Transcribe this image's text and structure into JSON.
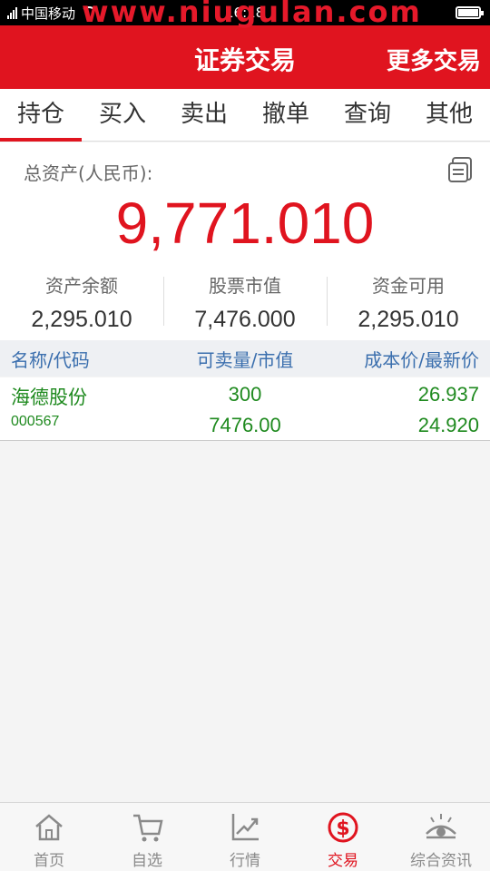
{
  "status": {
    "carrier": "中国移动",
    "time": "16:18",
    "watermark": "www.niugulan.com"
  },
  "header": {
    "title": "证券交易",
    "more": "更多交易"
  },
  "tabs": [
    "持仓",
    "买入",
    "卖出",
    "撤单",
    "查询",
    "其他"
  ],
  "assets": {
    "total_label": "总资产(人民币):",
    "total_value": "9,771.010",
    "stats": [
      {
        "label": "资产余额",
        "value": "2,295.010"
      },
      {
        "label": "股票市值",
        "value": "7,476.000"
      },
      {
        "label": "资金可用",
        "value": "2,295.010"
      }
    ]
  },
  "table": {
    "headers": [
      "名称/代码",
      "可卖量/市值",
      "成本价/最新价"
    ],
    "rows": [
      {
        "name": "海德股份",
        "code": "000567",
        "qty": "300",
        "market_value": "7476.00",
        "cost": "26.937",
        "price": "24.920"
      }
    ]
  },
  "nav": [
    {
      "label": "首页",
      "icon": "home-icon"
    },
    {
      "label": "自选",
      "icon": "cart-icon"
    },
    {
      "label": "行情",
      "icon": "trend-chart-icon"
    },
    {
      "label": "交易",
      "icon": "dollar-circle-icon"
    },
    {
      "label": "综合资讯",
      "icon": "eye-icon"
    }
  ],
  "colors": {
    "brand": "#e0141f",
    "gain_green": "#1f8a1f",
    "link_blue": "#3b6fae"
  }
}
